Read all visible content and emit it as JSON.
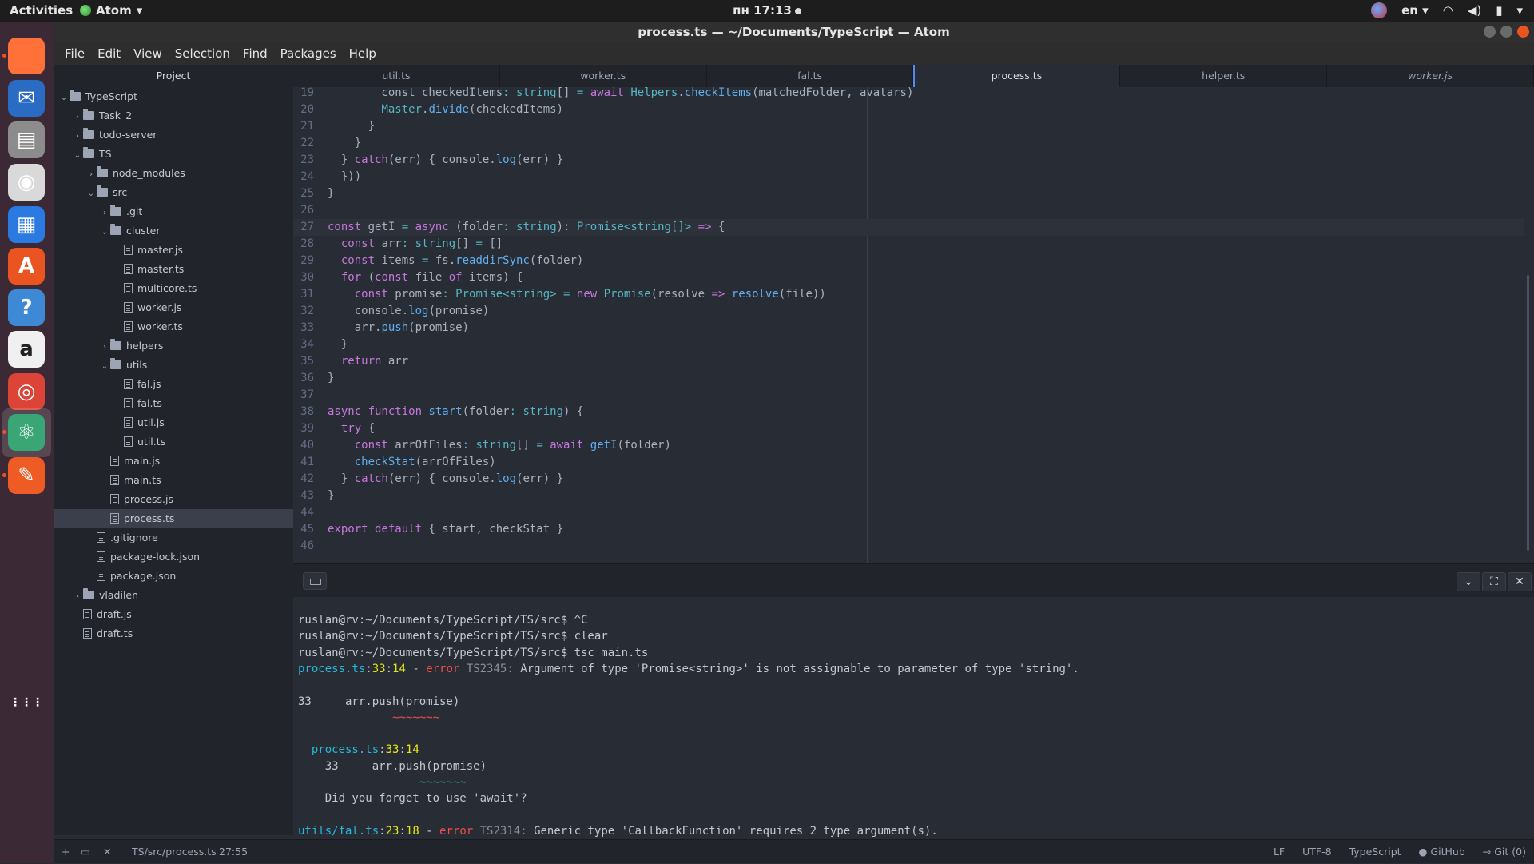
{
  "topbar": {
    "activities": "Activities",
    "app_name": "Atom",
    "clock": "пн 17:13",
    "lang": "en"
  },
  "window": {
    "title": "process.ts — ~/Documents/TypeScript — Atom"
  },
  "menu": [
    "File",
    "Edit",
    "View",
    "Selection",
    "Find",
    "Packages",
    "Help"
  ],
  "dock": [
    {
      "name": "firefox-icon",
      "glyph": "",
      "bg": "#ff7139"
    },
    {
      "name": "thunderbird-icon",
      "glyph": "✉",
      "bg": "#2a6cc4"
    },
    {
      "name": "files-icon",
      "glyph": "▤",
      "bg": "#8c8c8c"
    },
    {
      "name": "rhythmbox-icon",
      "glyph": "◉",
      "bg": "#d9d9d9"
    },
    {
      "name": "writer-icon",
      "glyph": "▦",
      "bg": "#2a7ae2"
    },
    {
      "name": "software-center-icon",
      "glyph": "A",
      "bg": "#e95420"
    },
    {
      "name": "help-icon",
      "glyph": "?",
      "bg": "#3d89d6"
    },
    {
      "name": "amazon-icon",
      "glyph": "a",
      "bg": "#f0f0f0"
    },
    {
      "name": "chrome-icon",
      "glyph": "◎",
      "bg": "#db4437"
    },
    {
      "name": "atom-icon",
      "glyph": "⚛",
      "bg": "#3aa676"
    },
    {
      "name": "postman-icon",
      "glyph": "✎",
      "bg": "#ef5b25"
    },
    {
      "name": "show-apps-icon",
      "glyph": "⋮⋮⋮",
      "bg": "transparent"
    }
  ],
  "sidebar": {
    "title": "Project",
    "tree": [
      {
        "label": "TypeScript",
        "kind": "folder",
        "depth": 0,
        "open": true
      },
      {
        "label": "Task_2",
        "kind": "folder",
        "depth": 1,
        "open": false
      },
      {
        "label": "todo-server",
        "kind": "folder",
        "depth": 1,
        "open": false
      },
      {
        "label": "TS",
        "kind": "folder",
        "depth": 1,
        "open": true
      },
      {
        "label": "node_modules",
        "kind": "folder",
        "depth": 2,
        "open": false
      },
      {
        "label": "src",
        "kind": "folder",
        "depth": 2,
        "open": true
      },
      {
        "label": ".git",
        "kind": "folder",
        "depth": 3,
        "open": false
      },
      {
        "label": "cluster",
        "kind": "folder",
        "depth": 3,
        "open": true
      },
      {
        "label": "master.js",
        "kind": "file",
        "depth": 4
      },
      {
        "label": "master.ts",
        "kind": "file",
        "depth": 4
      },
      {
        "label": "multicore.ts",
        "kind": "file",
        "depth": 4
      },
      {
        "label": "worker.js",
        "kind": "file",
        "depth": 4
      },
      {
        "label": "worker.ts",
        "kind": "file",
        "depth": 4
      },
      {
        "label": "helpers",
        "kind": "folder",
        "depth": 3,
        "open": false
      },
      {
        "label": "utils",
        "kind": "folder",
        "depth": 3,
        "open": true
      },
      {
        "label": "fal.js",
        "kind": "file",
        "depth": 4
      },
      {
        "label": "fal.ts",
        "kind": "file",
        "depth": 4
      },
      {
        "label": "util.js",
        "kind": "file",
        "depth": 4
      },
      {
        "label": "util.ts",
        "kind": "file",
        "depth": 4
      },
      {
        "label": "main.js",
        "kind": "file",
        "depth": 3
      },
      {
        "label": "main.ts",
        "kind": "file",
        "depth": 3
      },
      {
        "label": "process.js",
        "kind": "file",
        "depth": 3
      },
      {
        "label": "process.ts",
        "kind": "file",
        "depth": 3,
        "selected": true
      },
      {
        "label": ".gitignore",
        "kind": "file",
        "depth": 2
      },
      {
        "label": "package-lock.json",
        "kind": "file",
        "depth": 2
      },
      {
        "label": "package.json",
        "kind": "file",
        "depth": 2
      },
      {
        "label": "vladilen",
        "kind": "folder",
        "depth": 1,
        "open": false
      },
      {
        "label": "draft.js",
        "kind": "file",
        "depth": 1
      },
      {
        "label": "draft.ts",
        "kind": "file",
        "depth": 1
      }
    ]
  },
  "tabs": [
    {
      "label": "util.ts",
      "active": false
    },
    {
      "label": "worker.ts",
      "active": false
    },
    {
      "label": "fal.ts",
      "active": false
    },
    {
      "label": "process.ts",
      "active": true
    },
    {
      "label": "helper.ts",
      "active": false
    },
    {
      "label": "worker.js",
      "active": false,
      "italic": true
    }
  ],
  "editor": {
    "cursor_line": 27,
    "lines": [
      {
        "n": 19,
        "code": [
          [
            "pu",
            "        const checkedItems"
          ],
          [
            "ty",
            ": string"
          ],
          [
            "pu",
            "[] "
          ],
          [
            "ty",
            "= "
          ],
          [
            "kw",
            "await "
          ],
          [
            "ty",
            "Helpers"
          ],
          [
            "pu",
            "."
          ],
          [
            "fn",
            "checkItems"
          ],
          [
            "pu",
            "(matchedFolder, avatars)"
          ]
        ]
      },
      {
        "n": 20,
        "code": [
          [
            "pu",
            "        "
          ],
          [
            "ty",
            "Master"
          ],
          [
            "pu",
            "."
          ],
          [
            "fn",
            "divide"
          ],
          [
            "pu",
            "(checkedItems)"
          ]
        ]
      },
      {
        "n": 21,
        "code": [
          [
            "pu",
            "      }"
          ]
        ]
      },
      {
        "n": 22,
        "code": [
          [
            "pu",
            "    }"
          ]
        ]
      },
      {
        "n": 23,
        "code": [
          [
            "pu",
            "  } "
          ],
          [
            "kw",
            "catch"
          ],
          [
            "pu",
            "(err) { console."
          ],
          [
            "fn",
            "log"
          ],
          [
            "pu",
            "(err) }"
          ]
        ]
      },
      {
        "n": 24,
        "code": [
          [
            "pu",
            "  }))"
          ]
        ]
      },
      {
        "n": 25,
        "code": [
          [
            "pu",
            "}"
          ]
        ]
      },
      {
        "n": 26,
        "code": [
          [
            "pu",
            ""
          ]
        ]
      },
      {
        "n": 27,
        "code": [
          [
            "kw",
            "const "
          ],
          [
            "pu",
            "getI "
          ],
          [
            "ty",
            "= "
          ],
          [
            "kw",
            "async "
          ],
          [
            "pu",
            "(folder"
          ],
          [
            "ty",
            ": string"
          ],
          [
            "pu",
            "): "
          ],
          [
            "ty",
            "Promise<string[]> "
          ],
          [
            "kw",
            "=> "
          ],
          [
            "pu",
            "{"
          ]
        ]
      },
      {
        "n": 28,
        "code": [
          [
            "kw",
            "  const "
          ],
          [
            "pu",
            "arr"
          ],
          [
            "ty",
            ": string"
          ],
          [
            "pu",
            "[] "
          ],
          [
            "ty",
            "= "
          ],
          [
            "pu",
            "[]"
          ]
        ]
      },
      {
        "n": 29,
        "code": [
          [
            "kw",
            "  const "
          ],
          [
            "pu",
            "items "
          ],
          [
            "ty",
            "= "
          ],
          [
            "pu",
            "fs."
          ],
          [
            "fn",
            "readdirSync"
          ],
          [
            "pu",
            "(folder)"
          ]
        ]
      },
      {
        "n": 30,
        "code": [
          [
            "kw",
            "  for "
          ],
          [
            "pu",
            "("
          ],
          [
            "kw",
            "const "
          ],
          [
            "pu",
            "file "
          ],
          [
            "kw",
            "of "
          ],
          [
            "pu",
            "items) {"
          ]
        ]
      },
      {
        "n": 31,
        "code": [
          [
            "kw",
            "    const "
          ],
          [
            "pu",
            "promise"
          ],
          [
            "ty",
            ": Promise<string> = "
          ],
          [
            "kw",
            "new "
          ],
          [
            "ty",
            "Promise"
          ],
          [
            "pu",
            "(resolve "
          ],
          [
            "kw",
            "=> "
          ],
          [
            "fn",
            "resolve"
          ],
          [
            "pu",
            "(file))"
          ]
        ]
      },
      {
        "n": 32,
        "code": [
          [
            "pu",
            "    console."
          ],
          [
            "fn",
            "log"
          ],
          [
            "pu",
            "(promise)"
          ]
        ]
      },
      {
        "n": 33,
        "code": [
          [
            "pu",
            "    arr."
          ],
          [
            "fn",
            "push"
          ],
          [
            "pu",
            "(promise)"
          ]
        ]
      },
      {
        "n": 34,
        "code": [
          [
            "pu",
            "  }"
          ]
        ]
      },
      {
        "n": 35,
        "code": [
          [
            "kw",
            "  return "
          ],
          [
            "pu",
            "arr"
          ]
        ]
      },
      {
        "n": 36,
        "code": [
          [
            "pu",
            "}"
          ]
        ]
      },
      {
        "n": 37,
        "code": [
          [
            "pu",
            ""
          ]
        ]
      },
      {
        "n": 38,
        "code": [
          [
            "kw",
            "async function "
          ],
          [
            "fn",
            "start"
          ],
          [
            "pu",
            "(folder"
          ],
          [
            "ty",
            ": string"
          ],
          [
            "pu",
            ") {"
          ]
        ]
      },
      {
        "n": 39,
        "code": [
          [
            "kw",
            "  try "
          ],
          [
            "pu",
            "{"
          ]
        ]
      },
      {
        "n": 40,
        "code": [
          [
            "kw",
            "    const "
          ],
          [
            "pu",
            "arrOfFiles"
          ],
          [
            "ty",
            ": string"
          ],
          [
            "pu",
            "[] "
          ],
          [
            "ty",
            "= "
          ],
          [
            "kw",
            "await "
          ],
          [
            "fn",
            "getI"
          ],
          [
            "pu",
            "(folder)"
          ]
        ]
      },
      {
        "n": 41,
        "code": [
          [
            "fn",
            "    checkStat"
          ],
          [
            "pu",
            "(arrOfFiles)"
          ]
        ]
      },
      {
        "n": 42,
        "code": [
          [
            "pu",
            "  } "
          ],
          [
            "kw",
            "catch"
          ],
          [
            "pu",
            "(err) { console."
          ],
          [
            "fn",
            "log"
          ],
          [
            "pu",
            "(err) }"
          ]
        ]
      },
      {
        "n": 43,
        "code": [
          [
            "pu",
            "}"
          ]
        ]
      },
      {
        "n": 44,
        "code": [
          [
            "pu",
            ""
          ]
        ]
      },
      {
        "n": 45,
        "code": [
          [
            "kw",
            "export default "
          ],
          [
            "pu",
            "{ start, checkStat }"
          ]
        ]
      },
      {
        "n": 46,
        "code": [
          [
            "pu",
            ""
          ]
        ]
      }
    ]
  },
  "terminal": {
    "lines": [
      [
        [
          "plain",
          "ruslan@rv:~/Documents/TypeScript/TS/src$ ^C"
        ]
      ],
      [
        [
          "plain",
          "ruslan@rv:~/Documents/TypeScript/TS/src$ clear"
        ]
      ],
      [
        [
          "plain",
          "ruslan@rv:~/Documents/TypeScript/TS/src$ tsc main.ts"
        ]
      ],
      [
        [
          "cyan",
          "process.ts"
        ],
        [
          "plain",
          ":"
        ],
        [
          "yellow",
          "33"
        ],
        [
          "plain",
          ":"
        ],
        [
          "yellow",
          "14"
        ],
        [
          "plain",
          " - "
        ],
        [
          "red",
          "error"
        ],
        [
          "gray",
          " TS2345:"
        ],
        [
          "plain",
          " Argument of type 'Promise<string>' is not assignable to parameter of type 'string'."
        ]
      ],
      [
        [
          "plain",
          ""
        ]
      ],
      [
        [
          "plain",
          "33     arr.push(promise)"
        ]
      ],
      [
        [
          "red",
          "              ~~~~~~~"
        ]
      ],
      [
        [
          "plain",
          ""
        ]
      ],
      [
        [
          "cyan",
          "  process.ts"
        ],
        [
          "plain",
          ":"
        ],
        [
          "yellow",
          "33"
        ],
        [
          "plain",
          ":"
        ],
        [
          "yellow",
          "14"
        ]
      ],
      [
        [
          "plain",
          "    33     arr.push(promise)"
        ]
      ],
      [
        [
          "teal",
          "                  ~~~~~~~"
        ]
      ],
      [
        [
          "plain",
          "    Did you forget to use 'await'?"
        ]
      ],
      [
        [
          "plain",
          ""
        ]
      ],
      [
        [
          "cyan",
          "utils/fal.ts"
        ],
        [
          "plain",
          ":"
        ],
        [
          "yellow",
          "23"
        ],
        [
          "plain",
          ":"
        ],
        [
          "yellow",
          "18"
        ],
        [
          "plain",
          " - "
        ],
        [
          "red",
          "error"
        ],
        [
          "gray",
          " TS2314:"
        ],
        [
          "plain",
          " Generic type 'CallbackFunction' requires 2 type argument(s)."
        ]
      ]
    ]
  },
  "statusbar": {
    "path": "TS/src/process.ts",
    "cursor": "27:55",
    "eol": "LF",
    "encoding": "UTF-8",
    "grammar": "TypeScript",
    "github": "GitHub",
    "git": "Git (0)"
  }
}
